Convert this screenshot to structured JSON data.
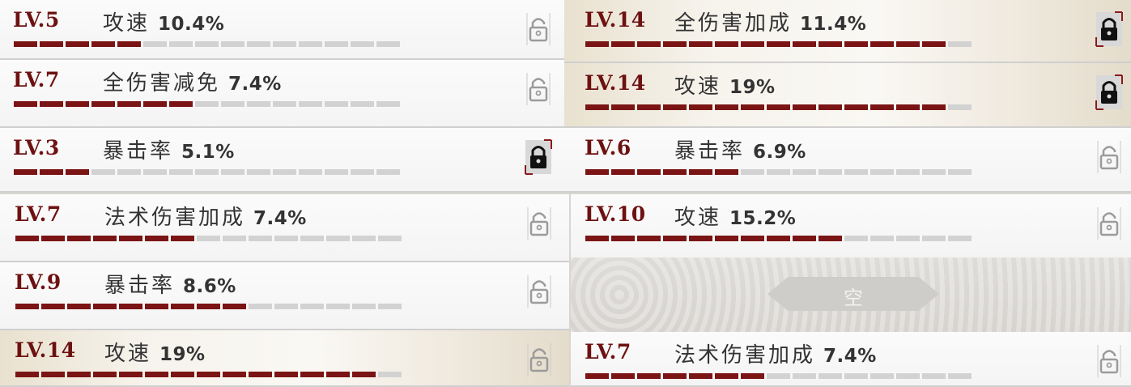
{
  "segment_total": 15,
  "colors": {
    "accent": "#7b1414",
    "bar_off": "#d2d2d2",
    "text": "#333333"
  },
  "lock_icon": "lock-icon",
  "panels": [
    {
      "rows": [
        {
          "level": "LV.5",
          "stat": "攻速",
          "value": "10.4%",
          "filled": 5,
          "style": "plain",
          "locked": false
        },
        {
          "level": "LV.7",
          "stat": "全伤害减免",
          "value": "7.4%",
          "filled": 7,
          "style": "plain",
          "locked": false
        },
        {
          "level": "LV.3",
          "stat": "暴击率",
          "value": "5.1%",
          "filled": 3,
          "style": "plain",
          "locked": true
        }
      ]
    },
    {
      "rows": [
        {
          "level": "LV.14",
          "stat": "全伤害加成",
          "value": "11.4%",
          "filled": 14,
          "style": "gold",
          "locked": true
        },
        {
          "level": "LV.14",
          "stat": "攻速",
          "value": "19%",
          "filled": 14,
          "style": "gold",
          "locked": true
        },
        {
          "level": "LV.6",
          "stat": "暴击率",
          "value": "6.9%",
          "filled": 6,
          "style": "plain",
          "locked": false
        }
      ]
    },
    {
      "rows": [
        {
          "level": "LV.7",
          "stat": "法术伤害加成",
          "value": "7.4%",
          "filled": 7,
          "style": "plain",
          "locked": false
        },
        {
          "level": "LV.9",
          "stat": "暴击率",
          "value": "8.6%",
          "filled": 9,
          "style": "plain",
          "locked": false
        },
        {
          "level": "LV.14",
          "stat": "攻速",
          "value": "19%",
          "filled": 14,
          "style": "gold",
          "locked": false
        }
      ]
    },
    {
      "rows": [
        {
          "level": "LV.10",
          "stat": "攻速",
          "value": "15.2%",
          "filled": 10,
          "style": "plain",
          "locked": false
        },
        {
          "level": "LV.7",
          "stat": "法术伤害加成",
          "value": "7.4%",
          "filled": 7,
          "style": "plain",
          "locked": false
        }
      ],
      "empty_slot": {
        "label": "空"
      }
    }
  ]
}
